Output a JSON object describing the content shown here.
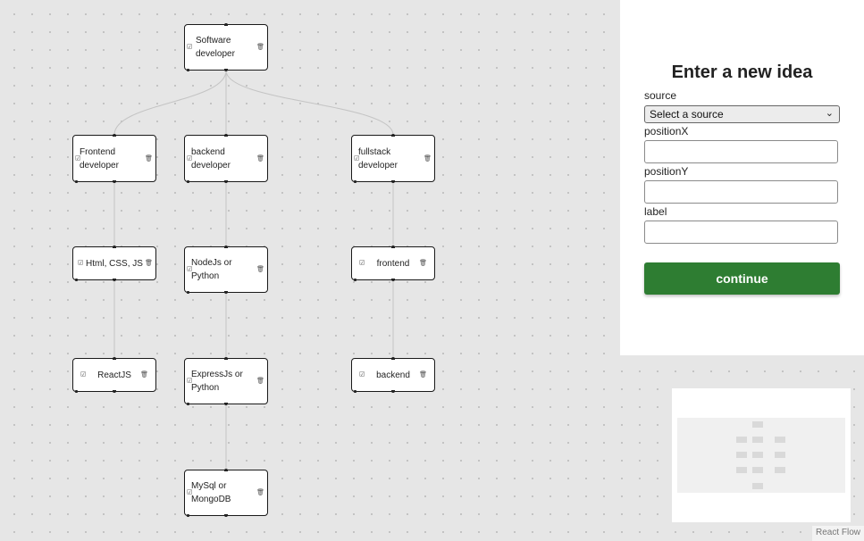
{
  "nodes": [
    {
      "id": "1",
      "label": "Software developer"
    },
    {
      "id": "2",
      "label": "Frontend developer"
    },
    {
      "id": "3",
      "label": "backend developer"
    },
    {
      "id": "4",
      "label": "fullstack developer"
    },
    {
      "id": "5",
      "label": "Html, CSS, JS"
    },
    {
      "id": "6",
      "label": "NodeJs or Python"
    },
    {
      "id": "7",
      "label": "frontend"
    },
    {
      "id": "8",
      "label": "ReactJS"
    },
    {
      "id": "9",
      "label": "ExpressJs or Python"
    },
    {
      "id": "10",
      "label": "backend"
    },
    {
      "id": "11",
      "label": "MySql or MongoDB"
    }
  ],
  "edges": [
    {
      "source": "1",
      "target": "2"
    },
    {
      "source": "1",
      "target": "3"
    },
    {
      "source": "1",
      "target": "4"
    },
    {
      "source": "2",
      "target": "5"
    },
    {
      "source": "3",
      "target": "6"
    },
    {
      "source": "4",
      "target": "7"
    },
    {
      "source": "5",
      "target": "8"
    },
    {
      "source": "6",
      "target": "9"
    },
    {
      "source": "7",
      "target": "10"
    },
    {
      "source": "9",
      "target": "11"
    }
  ],
  "node_icons": {
    "edit": "edit-icon",
    "delete": "delete-icon"
  },
  "form": {
    "title": "Enter a new idea",
    "source_label": "source",
    "source_value": "Select a source",
    "positionX_label": "positionX",
    "positionX_value": "",
    "positionY_label": "positionY",
    "positionY_value": "",
    "label_label": "label",
    "label_value": "",
    "continue_label": "continue"
  },
  "colors": {
    "accent": "#2e7d32",
    "canvas": "#e6e6e6",
    "edge": "#c4c4c4"
  },
  "attribution": "React Flow"
}
